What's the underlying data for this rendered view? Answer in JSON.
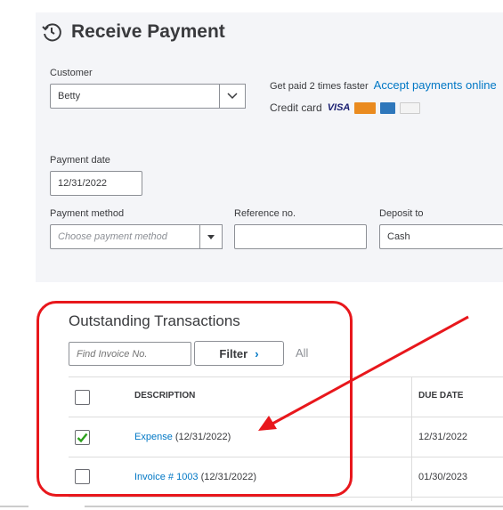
{
  "header": {
    "title": "Receive Payment",
    "icon": "payment-clock-icon"
  },
  "customer": {
    "label": "Customer",
    "value": "Betty"
  },
  "promo": {
    "text": "Get paid 2 times faster",
    "link": "Accept payments online",
    "credit_card_label": "Credit card",
    "visa_text": "VISA"
  },
  "payment_date": {
    "label": "Payment date",
    "value": "12/31/2022"
  },
  "payment_method": {
    "label": "Payment method",
    "placeholder": "Choose payment method"
  },
  "reference": {
    "label": "Reference no.",
    "value": ""
  },
  "deposit_to": {
    "label": "Deposit to",
    "value": "Cash"
  },
  "outstanding": {
    "title": "Outstanding Transactions",
    "search_placeholder": "Find Invoice No.",
    "filter_label": "Filter",
    "all_label": "All",
    "columns": [
      "DESCRIPTION",
      "DUE DATE"
    ],
    "rows": [
      {
        "checked": true,
        "link": "Expense",
        "date_text": "(12/31/2022)",
        "due_date": "12/31/2022"
      },
      {
        "checked": false,
        "link": "Invoice # 1003",
        "date_text": "(12/31/2022)",
        "due_date": "01/30/2023"
      }
    ]
  },
  "colors": {
    "accent": "#0077c5",
    "annotation": "#e8171c",
    "panel": "#f4f5f8",
    "check": "#2ca01c"
  }
}
